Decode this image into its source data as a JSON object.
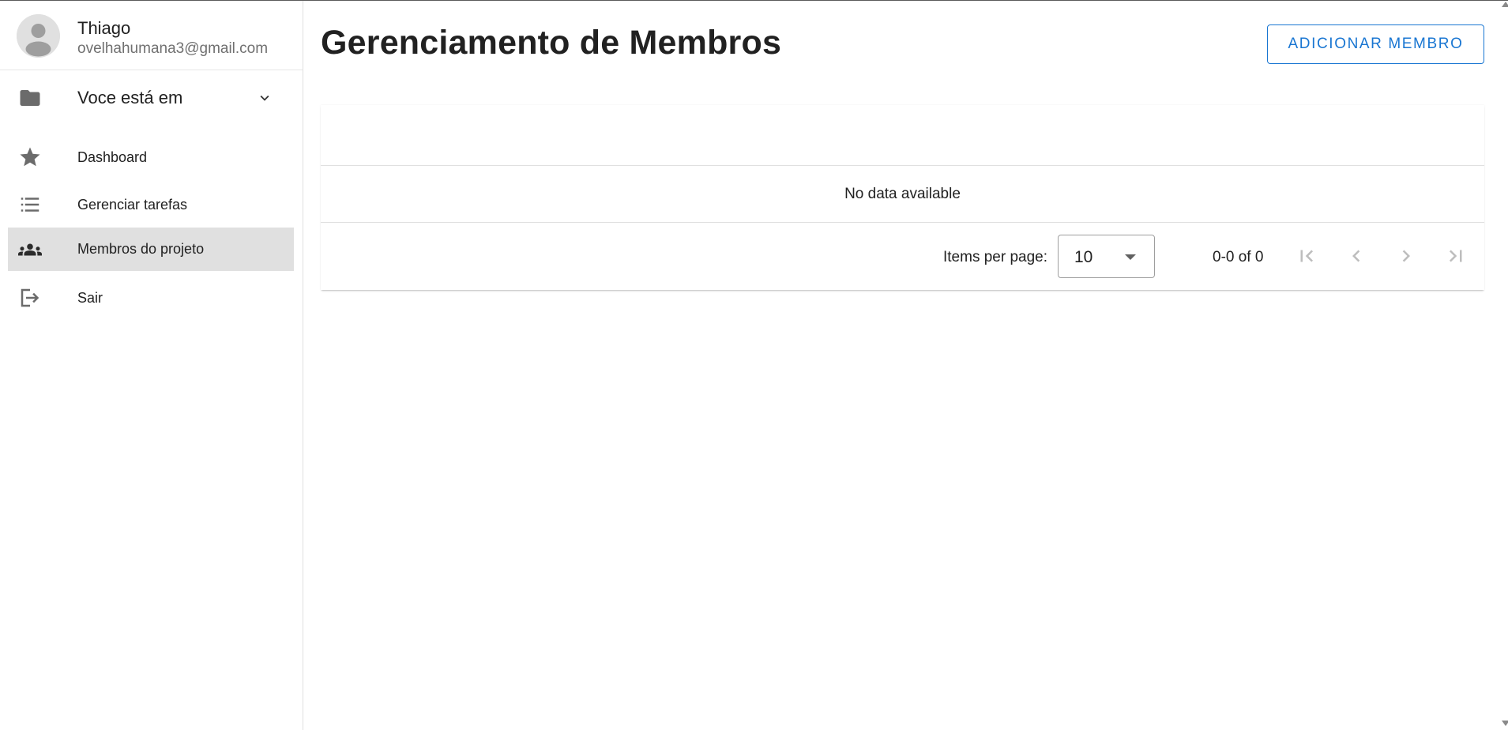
{
  "user": {
    "name": "Thiago",
    "email": "ovelhahumana3@gmail.com"
  },
  "sidebar": {
    "group": {
      "label": "Voce está em",
      "icon": "folder-icon",
      "expand_icon": "chevron-down-icon"
    },
    "items": [
      {
        "label": "Dashboard",
        "icon": "star-icon",
        "active": false
      },
      {
        "label": "Gerenciar tarefas",
        "icon": "list-icon",
        "active": false
      },
      {
        "label": "Membros do projeto",
        "icon": "group-icon",
        "active": true
      },
      {
        "label": "Sair",
        "icon": "logout-icon",
        "active": false
      }
    ]
  },
  "main": {
    "title": "Gerenciamento de Membros",
    "add_button_label": "ADICIONAR MEMBRO"
  },
  "table": {
    "empty_text": "No data available",
    "footer": {
      "items_per_page_label": "Items per page:",
      "items_per_page_value": "10",
      "range_text": "0-0 of 0"
    }
  },
  "colors": {
    "accent": "#1976d2",
    "active_item_bg": "#e0e0e0",
    "icon": "#6b6b6b"
  }
}
